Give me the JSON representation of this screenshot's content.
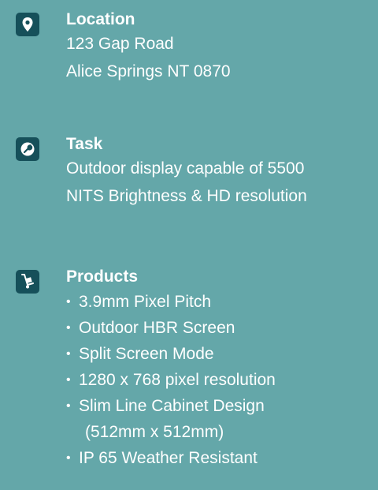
{
  "location": {
    "icon": "map-pin-icon",
    "heading": "Location",
    "lines": [
      "123 Gap Road",
      "Alice Springs NT 0870"
    ]
  },
  "task": {
    "icon": "wrench-icon",
    "heading": "Task",
    "lines": [
      "Outdoor display capable of 5500",
      "NITS Brightness & HD resolution"
    ]
  },
  "products": {
    "icon": "hand-truck-icon",
    "heading": "Products",
    "items": [
      "3.9mm Pixel Pitch",
      "Outdoor HBR  Screen",
      "Split Screen Mode",
      "1280 x 768 pixel resolution",
      "Slim Line Cabinet Design",
      "(512mm x 512mm)",
      "IP 65 Weather Resistant"
    ]
  },
  "colors": {
    "background": "#64a7a9",
    "icon_background": "#16505a",
    "text": "#ffffff"
  }
}
